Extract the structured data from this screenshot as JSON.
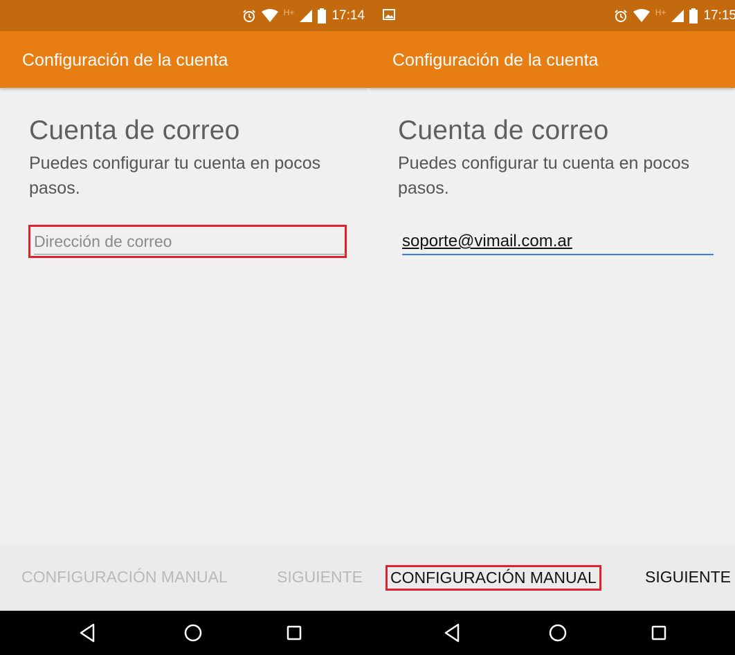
{
  "colors": {
    "status_bar": "#c46a0e",
    "app_bar": "#e87d13",
    "highlight_box": "#e0202a",
    "input_focus_line": "#3b7de6"
  },
  "left": {
    "status": {
      "time": "17:14",
      "network": "H+",
      "icons": [
        "alarm-icon",
        "wifi-icon",
        "signal-icon",
        "battery-icon"
      ]
    },
    "app_title": "Configuración de la cuenta",
    "heading": "Cuenta de correo",
    "subtext": "Puedes configurar tu cuenta en pocos pasos.",
    "email_placeholder": "Dirección de correo",
    "email_value": "",
    "manual_button": "CONFIGURACIÓN MANUAL",
    "next_button": "SIGUIENTE"
  },
  "right": {
    "status": {
      "time": "17:15",
      "network": "H+",
      "icons": [
        "image-notification-icon",
        "alarm-icon",
        "wifi-icon",
        "signal-icon",
        "battery-icon"
      ]
    },
    "app_title": "Configuración de la cuenta",
    "heading": "Cuenta de correo",
    "subtext": "Puedes configurar tu cuenta en pocos pasos.",
    "email_value": "soporte@vimail.com.ar",
    "manual_button": "CONFIGURACIÓN MANUAL",
    "next_button": "SIGUIENTE"
  },
  "nav": [
    "back-icon",
    "home-icon",
    "recents-icon"
  ]
}
